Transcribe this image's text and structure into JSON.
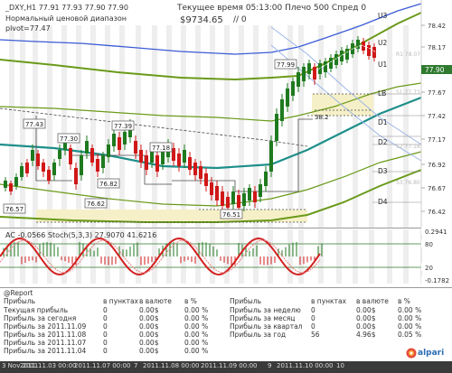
{
  "header": {
    "symbol_line": "_DXY,H1  77.91 77.93 77.90 77.90",
    "range_line": "Нормальный ценовой диапазон",
    "pivot_line": "pivot=77.47",
    "time_line": "Текущее время 05:13:00  Плечо 500  Спред 0",
    "balance": "$9734.65",
    "slash": "//  0"
  },
  "price_axis": {
    "ticks": [
      "78.42",
      "78.17",
      "77.92",
      "77.67",
      "77.42",
      "77.17",
      "76.92",
      "76.67",
      "76.42"
    ],
    "current_price": "77.90",
    "level_labels": [
      "U3",
      "U2",
      "U1",
      "LB",
      "D1",
      "D2",
      "D3",
      "D4"
    ],
    "faint_labels": [
      "R1 78.07",
      "S1 77.73",
      "S2 77.18",
      "S3 76.80"
    ]
  },
  "annotations": {
    "price_boxes": [
      "77.43",
      "77.30",
      "77.39",
      "77.18",
      "76.82",
      "76.62",
      "76.57",
      "76.51",
      "77.99"
    ],
    "fib": "38.2",
    "top_label": "77.99"
  },
  "oscillator": {
    "title": "AC -0.0566  Stoch(5,3,3) 27.9070 41.6216",
    "ticks": [
      "0.2941",
      "80",
      "20",
      "-0.1782"
    ]
  },
  "report": {
    "title": "@Report",
    "left_headers": [
      "Прибыль",
      "в пунктах",
      "в валюте",
      "в %"
    ],
    "left_rows": [
      [
        "Текущая прибыль",
        "0",
        "0.00$",
        "0.00 %"
      ],
      [
        "Прибыль за сегодня",
        "0",
        "0.00$",
        "0.00 %"
      ],
      [
        "Прибыль за 2011.11.09",
        "0",
        "0.00$",
        "0.00 %"
      ],
      [
        "Прибыль за 2011.11.08",
        "0",
        "0.00$",
        "0.00 %"
      ],
      [
        "Прибыль за 2011.11.07",
        "0",
        "0.00$",
        "0.00 %"
      ],
      [
        "Прибыль за 2011.11.04",
        "0",
        "0.00$",
        "0.00 %"
      ]
    ],
    "right_headers": [
      "Прибыль",
      "в пунктах",
      "в валюте",
      "в %"
    ],
    "right_rows": [
      [
        "Прибыль за неделю",
        "0",
        "0.00$",
        "0.00 %"
      ],
      [
        "Прибыль за месяц",
        "0",
        "0.00$",
        "0.00 %"
      ],
      [
        "Прибыль за квартал",
        "0",
        "0.00$",
        "0.00 %"
      ],
      [
        "Прибыль за год",
        "56",
        "4.96$",
        "0.05 %"
      ]
    ]
  },
  "time_axis": {
    "labels": [
      "3 Nov 2011",
      "2011.11.03 00:00",
      "2011.11.07 00:00",
      "7",
      "2011.11.08 00:00",
      "2011.11.09 00:00",
      "9",
      "2011.11.10 00:00",
      "10"
    ]
  },
  "logo": {
    "text": "alpari"
  },
  "colors": {
    "up_candle": "#1f7a1f",
    "down_candle": "#d01818",
    "band_green": "#6a9a1a",
    "band_blue": "#3b5bd6",
    "teal": "#1e8f8a",
    "level": "#4a4a4a"
  }
}
